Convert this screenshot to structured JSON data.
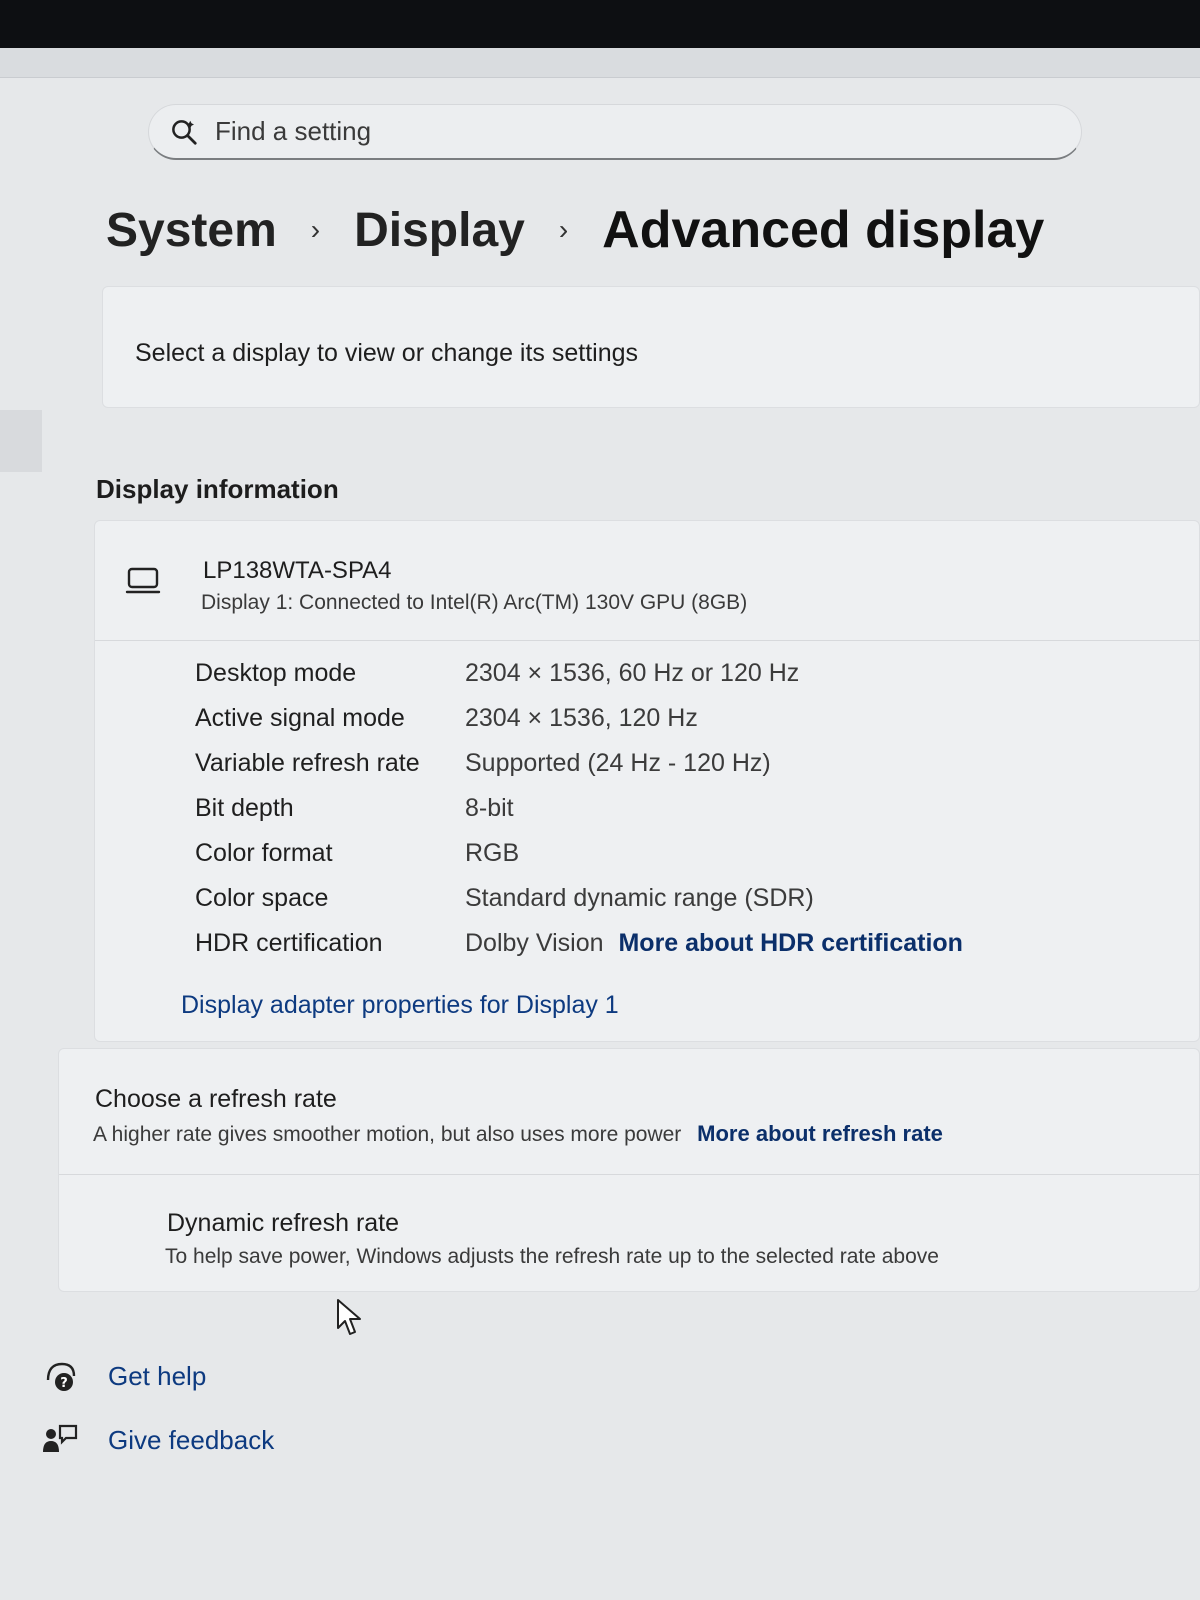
{
  "search": {
    "placeholder": "Find a setting"
  },
  "breadcrumb": {
    "items": [
      "System",
      "Display",
      "Advanced display"
    ],
    "separator": "›"
  },
  "select_display": {
    "text": "Select a display to view or change its settings"
  },
  "display_information": {
    "heading": "Display information",
    "monitor_name": "LP138WTA-SPA4",
    "monitor_desc": "Display 1: Connected to Intel(R) Arc(TM) 130V GPU (8GB)",
    "rows": [
      {
        "label": "Desktop mode",
        "value": "2304 × 1536, 60 Hz or 120 Hz"
      },
      {
        "label": "Active signal mode",
        "value": "2304 × 1536, 120 Hz"
      },
      {
        "label": "Variable refresh rate",
        "value": "Supported (24 Hz - 120 Hz)"
      },
      {
        "label": "Bit depth",
        "value": "8-bit"
      },
      {
        "label": "Color format",
        "value": "RGB"
      },
      {
        "label": "Color space",
        "value": "Standard dynamic range (SDR)"
      },
      {
        "label": "HDR certification",
        "value": "Dolby Vision",
        "link": "More about HDR certification"
      }
    ],
    "adapter_link": "Display adapter properties for Display 1"
  },
  "refresh": {
    "title": "Choose a refresh rate",
    "desc": "A higher rate gives smoother motion, but also uses more power",
    "link": "More about refresh rate",
    "dynamic_title": "Dynamic refresh rate",
    "dynamic_desc": "To help save power, Windows adjusts the refresh rate up to the selected rate above"
  },
  "footer": {
    "get_help": "Get help",
    "give_feedback": "Give feedback"
  },
  "colors": {
    "link": "#0d3a80",
    "background": "#e6e8ea",
    "card": "#eef0f2"
  }
}
